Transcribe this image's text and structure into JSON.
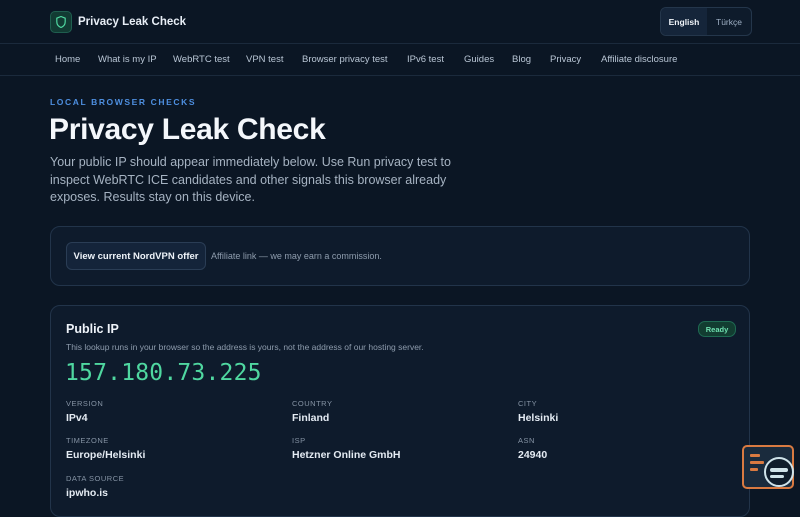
{
  "header": {
    "brand": "Privacy Leak Check",
    "brand_icon": "shield-icon",
    "languages": [
      "English",
      "Türkçe"
    ],
    "active_language": "English"
  },
  "nav": {
    "items": [
      "Home",
      "What is my IP",
      "WebRTC test",
      "VPN test",
      "Browser privacy test",
      "IPv6 test",
      "Guides",
      "Blog",
      "Privacy",
      "Affiliate disclosure"
    ]
  },
  "hero": {
    "eyebrow": "LOCAL BROWSER CHECKS",
    "title": "Privacy Leak Check",
    "intro": "Your public IP should appear immediately below. Use Run privacy test to inspect WebRTC ICE candidates and other signals this browser already exposes. Results stay on this device."
  },
  "affiliate": {
    "button_label": "View current NordVPN offer",
    "note": "Affiliate link — we may earn a commission."
  },
  "public_ip": {
    "title": "Public IP",
    "badge": "Ready",
    "description": "This lookup runs in your browser so the address is yours, not the address of our hosting server.",
    "address": "157.180.73.225",
    "fields": [
      {
        "label": "VERSION",
        "value": "IPv4"
      },
      {
        "label": "COUNTRY",
        "value": "Finland"
      },
      {
        "label": "CITY",
        "value": "Helsinki"
      },
      {
        "label": "TIMEZONE",
        "value": "Europe/Helsinki"
      },
      {
        "label": "ISP",
        "value": "Hetzner Online GmbH"
      },
      {
        "label": "ASN",
        "value": "24940"
      },
      {
        "label": "DATA SOURCE",
        "value": "ipwho.is"
      }
    ]
  },
  "colors": {
    "background": "#0b1624",
    "accent_green": "#4fd7a0",
    "accent_blue": "#4e8fe0",
    "helper_orange": "#d97a41"
  },
  "helper_widget": {
    "icon": "assistant-widget-icon"
  }
}
